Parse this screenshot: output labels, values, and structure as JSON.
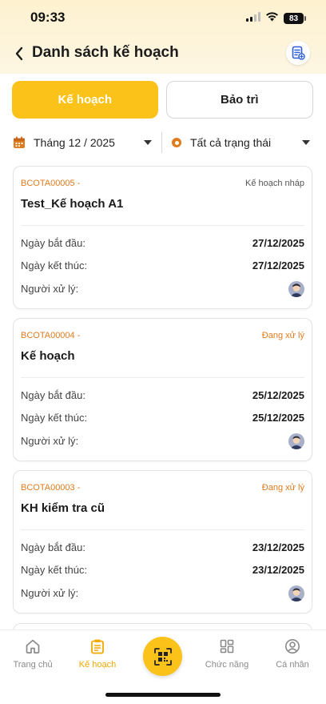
{
  "status_bar": {
    "time": "09:33",
    "battery": "83"
  },
  "header": {
    "title": "Danh sách kế hoạch"
  },
  "tabs": [
    {
      "label": "Kế hoạch",
      "active": true
    },
    {
      "label": "Bảo trì",
      "active": false
    }
  ],
  "filters": {
    "month": "Tháng 12 / 2025",
    "status": "Tất cả trạng thái"
  },
  "labels": {
    "start": "Ngày bắt đầu:",
    "end": "Ngày kết thúc:",
    "assignee": "Người xử lý:"
  },
  "plans": [
    {
      "code": "BCOTA00005 -",
      "status": "Kế hoạch nháp",
      "status_color": "#555555",
      "title": "Test_Kế hoạch A1",
      "start": "27/12/2025",
      "end": "27/12/2025"
    },
    {
      "code": "BCOTA00004 -",
      "status": "Đang xử lý",
      "status_color": "#e07b1e",
      "title": "Kế hoạch",
      "start": "25/12/2025",
      "end": "25/12/2025"
    },
    {
      "code": "BCOTA00003 -",
      "status": "Đang xử lý",
      "status_color": "#e07b1e",
      "title": "KH kiểm tra cũ",
      "start": "23/12/2025",
      "end": "23/12/2025"
    }
  ],
  "bottom_nav": [
    {
      "label": "Trang chủ",
      "icon": "home-icon",
      "active": false
    },
    {
      "label": "Kế hoạch",
      "icon": "clipboard-icon",
      "active": true
    },
    {
      "label": "Chức năng",
      "icon": "grid-icon",
      "active": false
    },
    {
      "label": "Cá nhân",
      "icon": "user-icon",
      "active": false
    }
  ],
  "colors": {
    "accent": "#fbc21a",
    "orange": "#e07b1e",
    "active_nav": "#f2a900"
  }
}
